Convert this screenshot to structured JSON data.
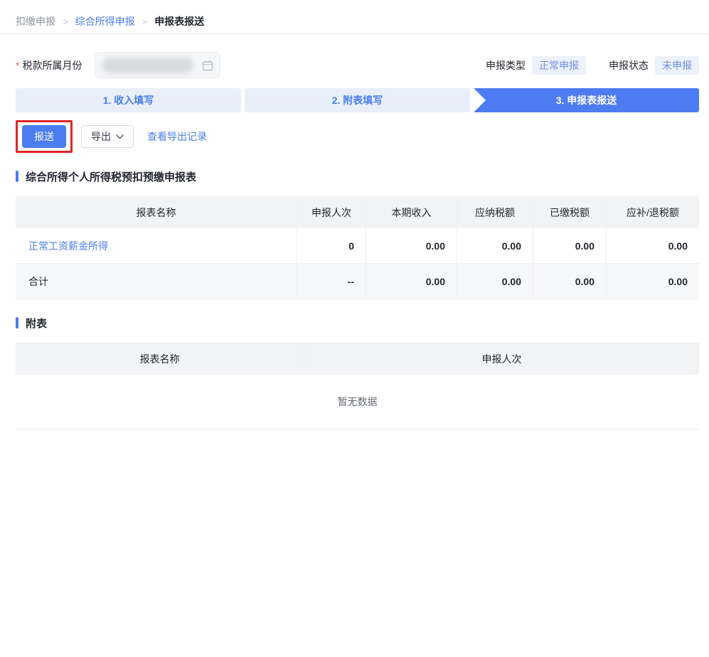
{
  "breadcrumb": {
    "separator": ">",
    "items": [
      {
        "label": "扣缴申报"
      },
      {
        "label": "综合所得申报"
      },
      {
        "label": "申报表报送"
      }
    ]
  },
  "filter": {
    "required_mark": "*",
    "label": "税款所属月份",
    "value_redacted": true
  },
  "declaration_meta": {
    "type_label": "申报类型",
    "type_value": "正常申报",
    "status_label": "申报状态",
    "status_value": "未申报"
  },
  "steps": [
    {
      "label": "1. 收入填写",
      "active": false
    },
    {
      "label": "2. 附表填写",
      "active": false
    },
    {
      "label": "3. 申报表报送",
      "active": true
    }
  ],
  "toolbar": {
    "submit_label": "报送",
    "export_label": "导出",
    "view_export_records_label": "查看导出记录"
  },
  "main_table": {
    "title": "综合所得个人所得税预扣预缴申报表",
    "headers": [
      "报表名称",
      "申报人次",
      "本期收入",
      "应纳税额",
      "已缴税额",
      "应补/退税额"
    ],
    "rows": [
      {
        "name": "正常工资薪金所得",
        "values": [
          "0",
          "0.00",
          "0.00",
          "0.00",
          "0.00"
        ]
      },
      {
        "name": "合计",
        "values": [
          "--",
          "0.00",
          "0.00",
          "0.00",
          "0.00"
        ]
      }
    ]
  },
  "appendix_table": {
    "title": "附表",
    "headers": [
      "报表名称",
      "申报人次"
    ],
    "empty_text": "暂无数据"
  },
  "icons": {
    "date_picker": "calendar-icon",
    "export_menu": "chevron-down-icon"
  },
  "colors": {
    "primary_blue": "#4b7cf0",
    "step_active_bg": "#4d7cf2",
    "step_inactive_bg": "#e8effb",
    "badge_bg": "#edf1f9",
    "badge_text": "#6e8fe3",
    "link_blue": "#4b7df0",
    "annotation_red": "#e02525",
    "header_bg": "#f2f3f5",
    "subtotal_bg": "#f7f8fa"
  }
}
